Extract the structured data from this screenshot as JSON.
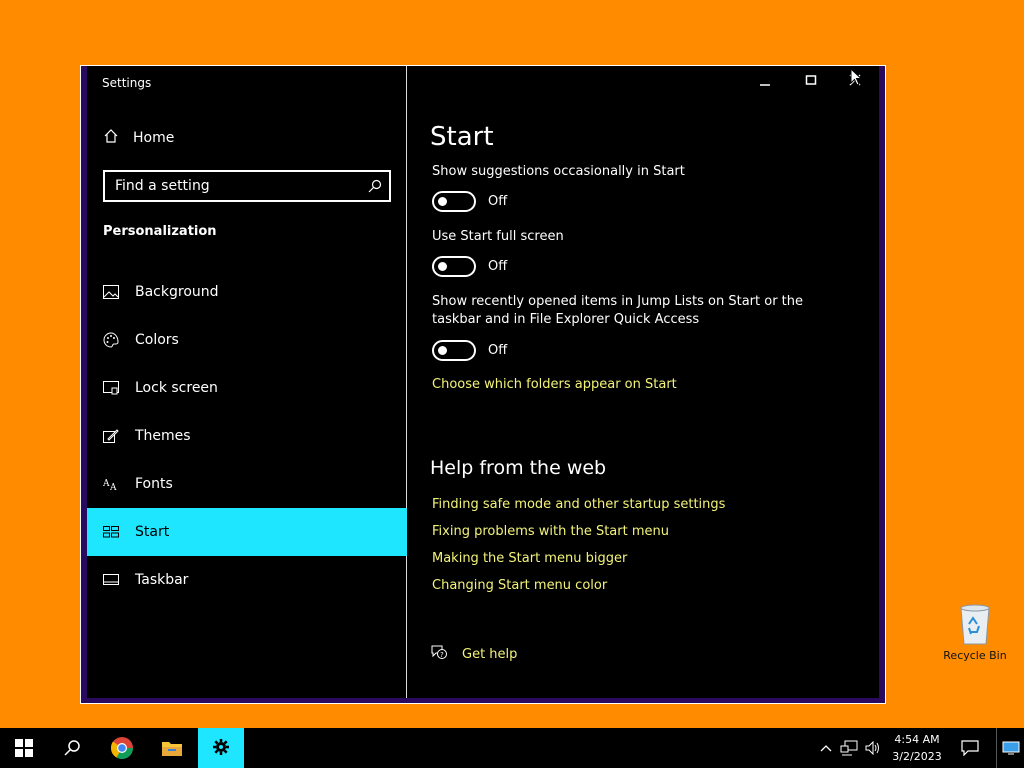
{
  "window": {
    "title": "Settings"
  },
  "sidebar": {
    "home_label": "Home",
    "search_placeholder": "Find a setting",
    "section_title": "Personalization",
    "items": [
      {
        "label": "Background",
        "icon": "picture-icon"
      },
      {
        "label": "Colors",
        "icon": "palette-icon"
      },
      {
        "label": "Lock screen",
        "icon": "lock-screen-icon"
      },
      {
        "label": "Themes",
        "icon": "brush-icon"
      },
      {
        "label": "Fonts",
        "icon": "fonts-icon"
      },
      {
        "label": "Start",
        "icon": "start-tiles-icon",
        "selected": true
      },
      {
        "label": "Taskbar",
        "icon": "taskbar-icon"
      }
    ]
  },
  "content": {
    "title": "Start",
    "settings": [
      {
        "label": "Show suggestions occasionally in Start",
        "state": "Off"
      },
      {
        "label": "Use Start full screen",
        "state": "Off"
      },
      {
        "label": "Show recently opened items in Jump Lists on Start or the taskbar and in File Explorer Quick Access",
        "state": "Off"
      }
    ],
    "folders_link": "Choose which folders appear on Start",
    "help_title": "Help from the web",
    "help_links": [
      "Finding safe mode and other startup settings",
      "Fixing problems with the Start menu",
      "Making the Start menu bigger",
      "Changing Start menu color"
    ],
    "get_help": "Get help"
  },
  "desktop": {
    "recycle_bin_label": "Recycle Bin"
  },
  "taskbar": {
    "time": "4:54 AM",
    "date": "3/2/2023",
    "apps": [
      "start-icon",
      "search-icon",
      "chrome-icon",
      "file-explorer-icon",
      "settings-icon"
    ]
  },
  "colors": {
    "desktop": "#FF8C00",
    "accent": "#1EE6FF",
    "link": "#F3F37A"
  }
}
